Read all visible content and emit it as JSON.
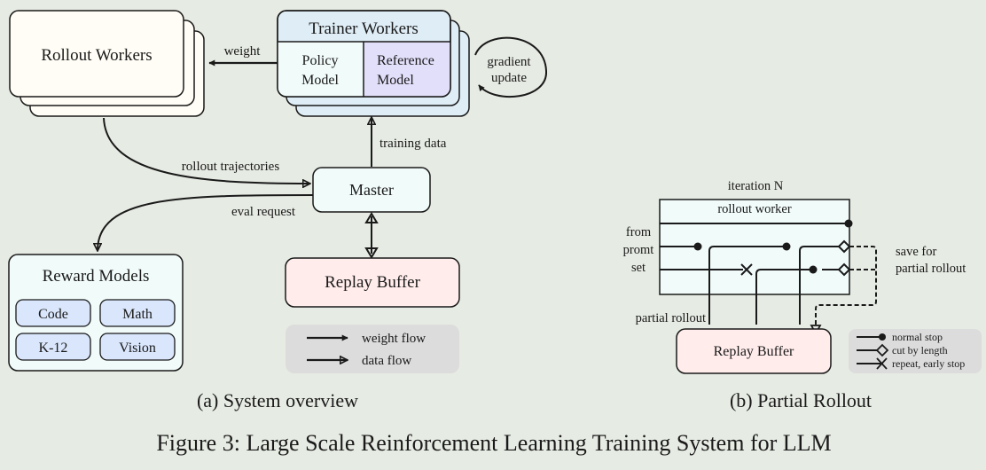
{
  "colors": {
    "background": "#e6ebe3",
    "rollout_fill": "#fffdf5",
    "trainer_fill": "#dfedf6",
    "policy_fill": "#f1fbfa",
    "reference_fill": "#e2dffa",
    "master_fill": "#f1fbfa",
    "reward_fill": "#f1fbfa",
    "reward_item_fill": "#d9e6fb",
    "replay_fill": "#ffeceb",
    "legend_fill": "#dcdcdc",
    "stroke": "#1a1a1a"
  },
  "system_overview": {
    "rollout_workers": {
      "title": "Rollout Workers"
    },
    "trainer_workers": {
      "title": "Trainer Workers",
      "policy_model": [
        "Policy",
        "Model"
      ],
      "reference_model": [
        "Reference",
        "Model"
      ]
    },
    "gradient_update": [
      "gradient",
      "update"
    ],
    "edges": {
      "weight": "weight",
      "training_data": "training data",
      "rollout_trajectories": "rollout trajectories",
      "eval_request": "eval request"
    },
    "master": {
      "title": "Master"
    },
    "replay_buffer": {
      "title": "Replay Buffer"
    },
    "reward_models": {
      "title": "Reward Models",
      "items": [
        "Code",
        "Math",
        "K-12",
        "Vision"
      ]
    },
    "legend": {
      "weight_flow": "weight flow",
      "data_flow": "data flow"
    },
    "caption": "(a) System overview"
  },
  "partial_rollout": {
    "iteration_label": "iteration N",
    "rollout_worker": "rollout worker",
    "from_prompt_set": [
      "from",
      "promt",
      "set"
    ],
    "save_for_partial": [
      "save for",
      "partial rollout"
    ],
    "partial_rollout_label": "partial rollout",
    "replay_buffer": "Replay Buffer",
    "legend": {
      "normal_stop": "normal stop",
      "cut_by_length": "cut by length",
      "repeat_early_stop": "repeat, early stop"
    },
    "caption": "(b) Partial Rollout"
  },
  "figure_caption": "Figure 3: Large Scale Reinforcement Learning Training System for LLM"
}
